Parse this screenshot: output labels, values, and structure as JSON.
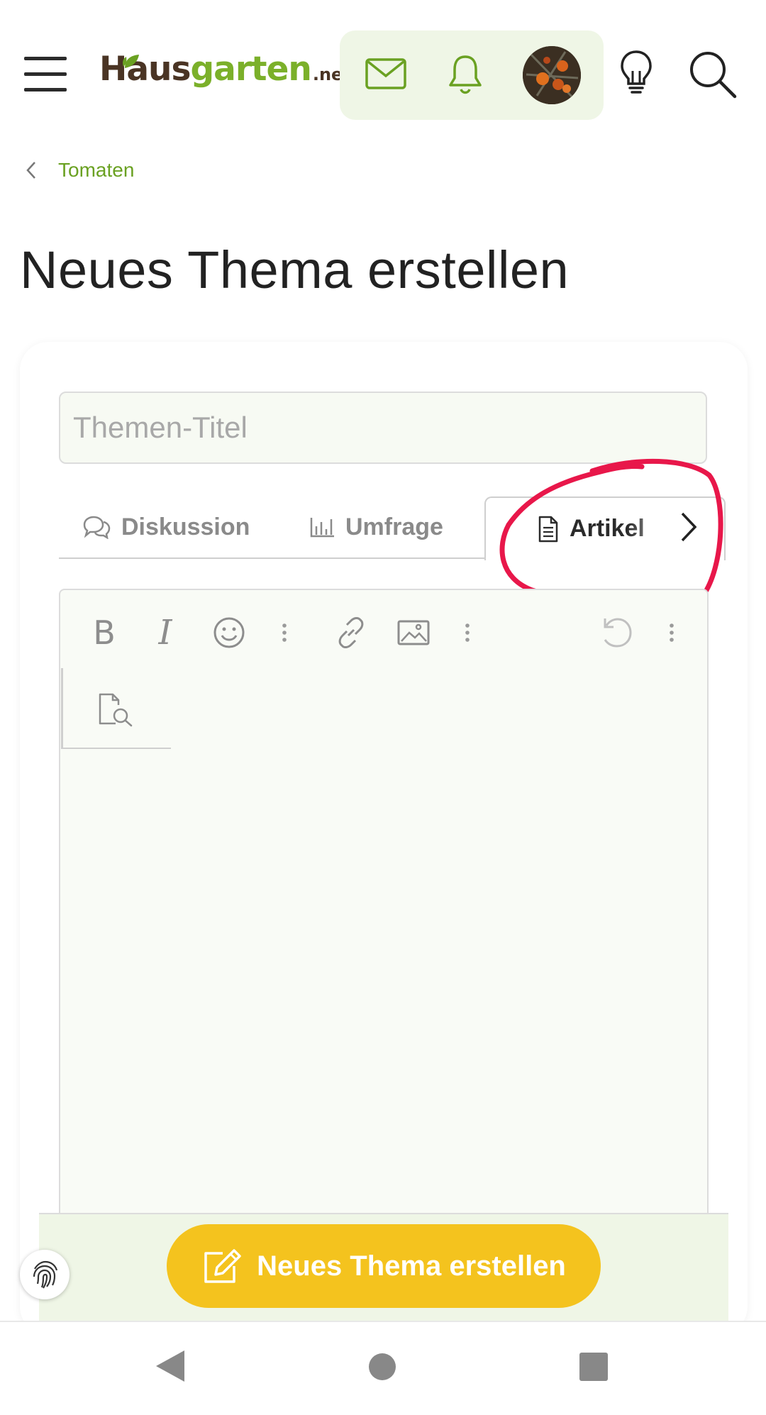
{
  "header": {
    "logo": {
      "part1": "Haus",
      "part2": "garten",
      "part3": ".net"
    },
    "icons": {
      "menu": "hamburger-menu-icon",
      "messages": "envelope-icon",
      "alerts": "bell-icon",
      "ideas": "lightbulb-icon",
      "search": "search-icon"
    }
  },
  "breadcrumb": {
    "back_icon": "chevron-left-icon",
    "label": "Tomaten"
  },
  "page": {
    "title": "Neues Thema erstellen"
  },
  "form": {
    "title_placeholder": "Themen-Titel",
    "tabs": [
      {
        "label": "Diskussion",
        "icon": "speech-bubbles-icon",
        "active": false
      },
      {
        "label": "Umfrage",
        "icon": "bar-chart-icon",
        "active": false
      },
      {
        "label": "Artikel",
        "icon": "document-icon",
        "active": true
      }
    ],
    "editor_tools": [
      "bold",
      "italic",
      "emoji",
      "more",
      "link",
      "image",
      "more",
      "undo",
      "more",
      "preview"
    ],
    "bold_glyph": "B",
    "italic_glyph": "I",
    "submit_label": "Neues Thema erstellen"
  },
  "colors": {
    "brand_green": "#6aa122",
    "logo_brown": "#4a3424",
    "submit_yellow": "#f4c31e",
    "annotation_red": "#e8174a",
    "panel_green": "#eff6e6"
  }
}
